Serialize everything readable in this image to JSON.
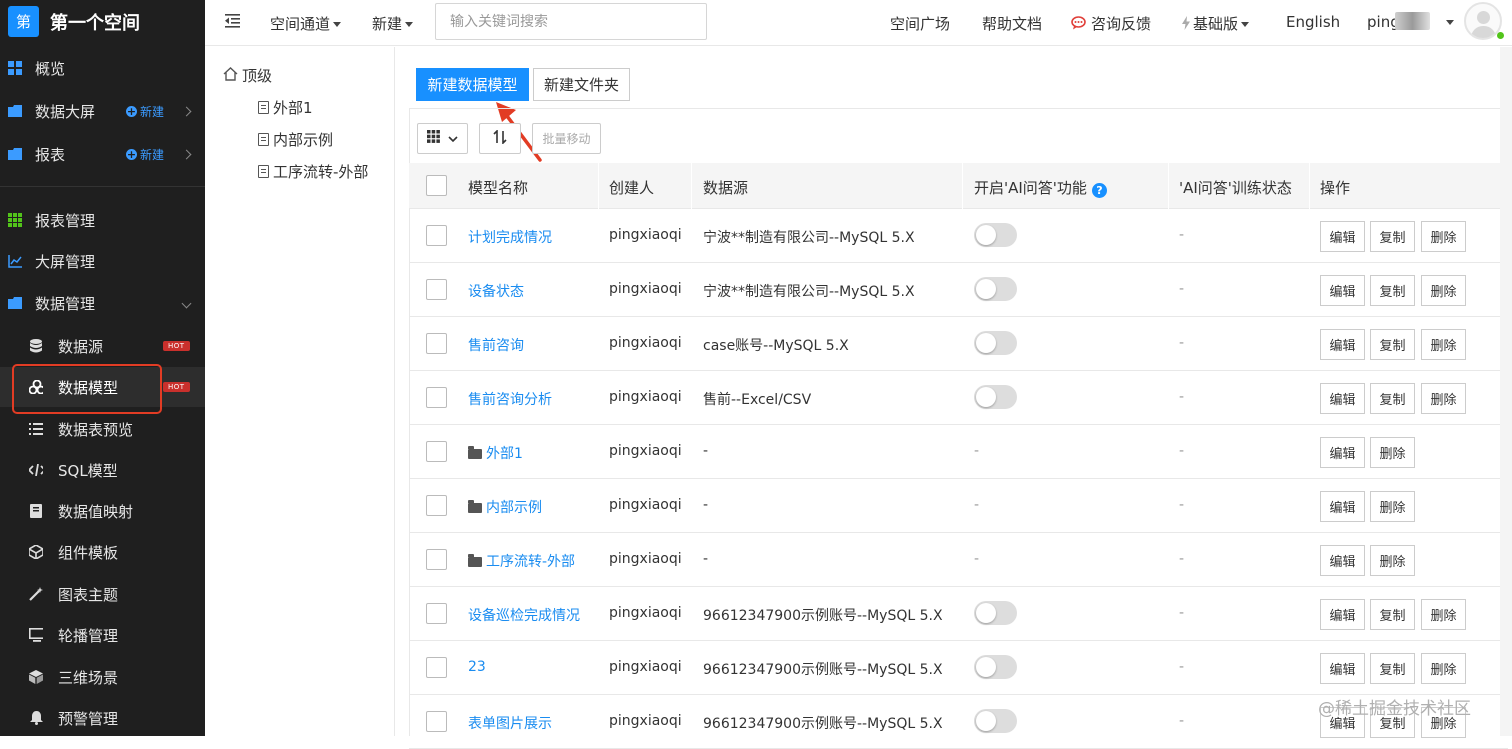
{
  "app": {
    "logo_char": "第",
    "space_name": "第一个空间"
  },
  "sidebar": {
    "items": [
      {
        "label": "概览",
        "icon": "grid-icon"
      },
      {
        "label": "数据大屏",
        "icon": "folder-icon",
        "new": "新建"
      },
      {
        "label": "报表",
        "icon": "folder-icon",
        "new": "新建"
      },
      {
        "label": "报表管理",
        "icon": "grid-icon"
      },
      {
        "label": "大屏管理",
        "icon": "line-chart-icon"
      },
      {
        "label": "数据管理",
        "icon": "folder-icon"
      }
    ],
    "sub_items": [
      {
        "label": "数据源",
        "icon": "database-icon",
        "badge": "HOT"
      },
      {
        "label": "数据模型",
        "icon": "cubes-icon",
        "badge": "HOT"
      },
      {
        "label": "数据表预览",
        "icon": "list-icon"
      },
      {
        "label": "SQL模型",
        "icon": "code-icon"
      },
      {
        "label": "数据值映射",
        "icon": "book-icon"
      },
      {
        "label": "组件模板",
        "icon": "component-icon"
      },
      {
        "label": "图表主题",
        "icon": "magic-wand-icon"
      },
      {
        "label": "轮播管理",
        "icon": "monitor-icon"
      },
      {
        "label": "三维场景",
        "icon": "cube-icon"
      },
      {
        "label": "预警管理",
        "icon": "bell-icon"
      }
    ]
  },
  "topbar": {
    "channel": "空间通道",
    "new": "新建",
    "search_placeholder": "输入关键词搜索",
    "plaza": "空间广场",
    "docs": "帮助文档",
    "feedback": "咨询反馈",
    "plan": "基础版",
    "language": "English",
    "user": "ping"
  },
  "tree": {
    "root": "顶级",
    "children": [
      "外部1",
      "内部示例",
      "工序流转-外部"
    ]
  },
  "actions": {
    "new_model": "新建数据模型",
    "new_folder": "新建文件夹",
    "batch_move": "批量移动"
  },
  "table": {
    "headers": [
      "模型名称",
      "创建人",
      "数据源",
      "开启'AI问答'功能",
      "'AI问答'训练状态",
      "操作"
    ],
    "op_labels": {
      "edit": "编辑",
      "copy": "复制",
      "delete": "删除"
    },
    "rows": [
      {
        "name": "计划完成情况",
        "creator": "pingxiaoqi",
        "source": "宁波**制造有限公司--MySQL 5.X",
        "folder": false,
        "ai": "",
        "status": "-"
      },
      {
        "name": "设备状态",
        "creator": "pingxiaoqi",
        "source": "宁波**制造有限公司--MySQL 5.X",
        "folder": false,
        "ai": "",
        "status": "-"
      },
      {
        "name": "售前咨询",
        "creator": "pingxiaoqi",
        "source": "case账号--MySQL 5.X",
        "folder": false,
        "ai": "",
        "status": "-"
      },
      {
        "name": "售前咨询分析",
        "creator": "pingxiaoqi",
        "source": "售前--Excel/CSV",
        "folder": false,
        "ai": "",
        "status": "-"
      },
      {
        "name": "外部1",
        "creator": "pingxiaoqi",
        "source": "-",
        "folder": true,
        "ai": "-",
        "status": "-"
      },
      {
        "name": "内部示例",
        "creator": "pingxiaoqi",
        "source": "-",
        "folder": true,
        "ai": "-",
        "status": "-"
      },
      {
        "name": "工序流转-外部",
        "creator": "pingxiaoqi",
        "source": "-",
        "folder": true,
        "ai": "-",
        "status": "-"
      },
      {
        "name": "设备巡检完成情况",
        "creator": "pingxiaoqi",
        "source": "96612347900示例账号--MySQL 5.X",
        "folder": false,
        "ai": "",
        "status": "-"
      },
      {
        "name": "23",
        "creator": "pingxiaoqi",
        "source": "96612347900示例账号--MySQL 5.X",
        "folder": false,
        "ai": "",
        "status": "-"
      },
      {
        "name": "表单图片展示",
        "creator": "pingxiaoqi",
        "source": "96612347900示例账号--MySQL 5.X",
        "folder": false,
        "ai": "",
        "status": "-"
      }
    ]
  },
  "watermark": "@稀土掘金技术社区",
  "colors": {
    "primary": "#1890ff",
    "sidebar_bg": "#1f1f1f",
    "hot": "#c9302c",
    "highlight": "#e23c24",
    "link": "#1a8cf0"
  }
}
